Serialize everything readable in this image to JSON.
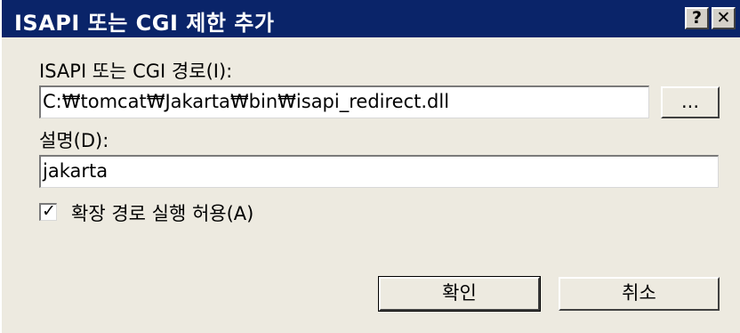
{
  "dialog": {
    "title": "ISAPI 또는 CGI 제한 추가",
    "help_button": "?",
    "close_button": "✕"
  },
  "path_field": {
    "label": "ISAPI 또는 CGI 경로(I):",
    "value": "C:₩tomcat₩Jakarta₩bin₩isapi_redirect.dll",
    "browse_label": "..."
  },
  "description_field": {
    "label": "설명(D):",
    "value": "jakarta"
  },
  "allow_extension": {
    "checked": true,
    "label": "확장 경로 실행 허용(A)"
  },
  "buttons": {
    "ok": "확인",
    "cancel": "취소"
  },
  "colors": {
    "titlebar": "#0a2469",
    "dialog_bg": "#edeae0"
  }
}
